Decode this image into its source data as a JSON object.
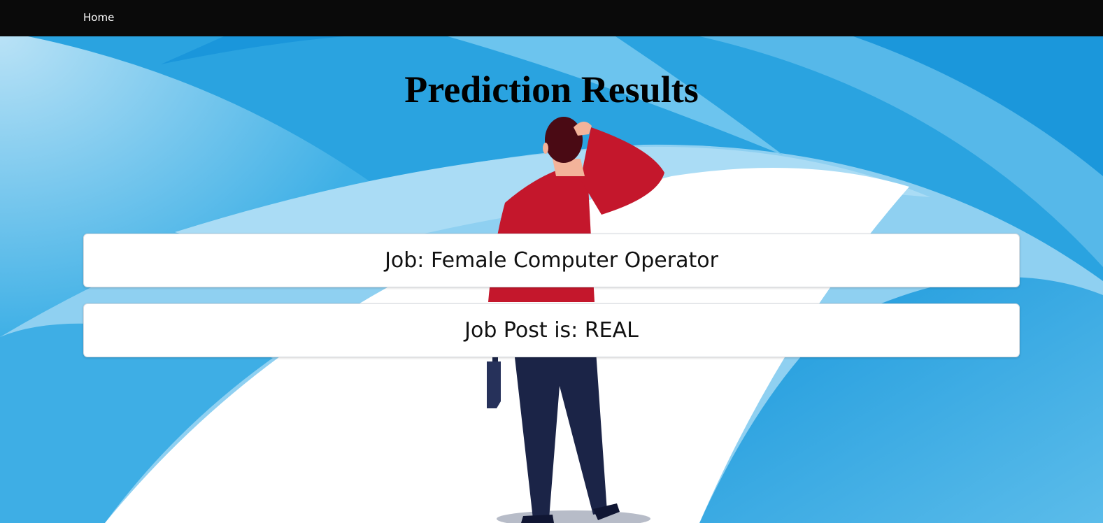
{
  "navbar": {
    "home_label": "Home"
  },
  "page": {
    "title": "Prediction Results"
  },
  "results": {
    "job_text": "Job: Female Computer Operator",
    "post_text": "Job Post is: REAL"
  },
  "colors": {
    "navbar_bg": "#0a0a0a",
    "background_blue": "#2aa3e0",
    "shirt_red": "#c4172c",
    "pants_navy": "#1b2447",
    "hair": "#4a0a14"
  },
  "icons": {
    "background_illustration": "person-looking-at-road-illustration"
  }
}
